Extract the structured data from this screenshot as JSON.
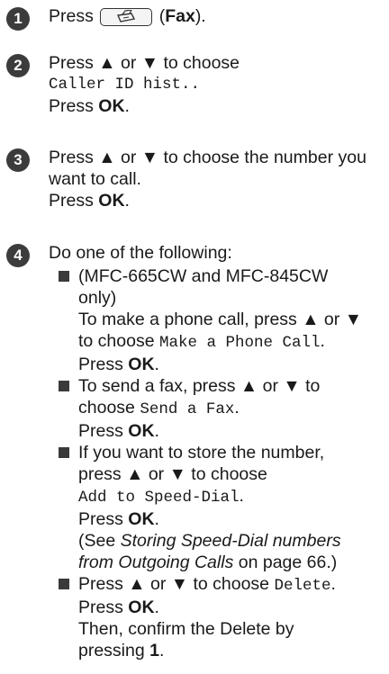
{
  "steps": [
    {
      "num": "1"
    },
    {
      "num": "2",
      "mono": "Caller ID hist.."
    },
    {
      "num": "3"
    },
    {
      "num": "4",
      "intro": "Do one of the following:"
    }
  ],
  "text": {
    "press": "Press",
    "fax_word": "Fax",
    "press_updown_choose": "Press ▲ or ▼ to choose",
    "press_ok": "OK",
    "step3_a": "Press ▲ or ▼ to choose the number you",
    "step3_b": "want to call."
  },
  "icons": {
    "fax_button": "fax-machine-icon",
    "bullet": "square-bullet"
  },
  "options": {
    "a_line1": "(MFC-665CW and MFC-845CW",
    "a_line2": "only)",
    "a_line3": "To make a phone call, press ▲ or ▼",
    "a_line4_pre": "to choose",
    "a_mono": "Make a Phone Call",
    "b_line1": "To send a fax, press ▲ or ▼ to",
    "b_line2_pre": "choose",
    "b_mono": "Send a Fax",
    "c_line1": "If you want to store the number,",
    "c_line2": "press ▲ or ▼ to choose",
    "c_mono": "Add to Speed-Dial",
    "c_see_pre": "(See",
    "c_see_italic1": "Storing Speed-Dial numbers",
    "c_see_italic2": "from Outgoing Calls",
    "c_see_post": "on page 66.)",
    "d_line1_pre": "Press ▲ or ▼ to choose",
    "d_mono": "Delete",
    "d_line3": "Then, confirm the Delete by",
    "d_line4_pre": "pressing",
    "d_key": "1"
  }
}
